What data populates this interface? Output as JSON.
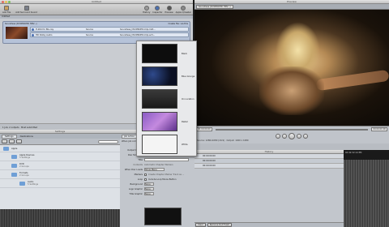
{
  "compressor": {
    "title": "Untitled",
    "toolbar": [
      "Add File",
      "Add Surround Sound"
    ],
    "right_tools": [
      "History",
      "Inspector",
      "Preview",
      "Apple Qmaster"
    ],
    "batch_tab": "Untitled",
    "job_name": "Soundless (DVCPROHD HDV...)",
    "create_file_label": "Create file: via this",
    "targets": [
      {
        "setting": "H.264 for Blu-ray",
        "dest": "Source",
        "output": "Soundless_DVCPROHD-Clip.m2t..."
      },
      {
        "setting": "HD Dolby Audio",
        "dest": "Source",
        "output": "Soundless_DVCPROHD-Clip.ac3..."
      }
    ],
    "status": "1 Job, 2 outputs · Most submitted"
  },
  "templates": {
    "items": [
      "Black",
      "Blue Grunge",
      "On Location",
      "Pastel",
      "White"
    ]
  },
  "settings": {
    "title": "Settings",
    "tabs": [
      "Settings",
      "Destinations"
    ],
    "groups": [
      {
        "name": "Apple",
        "count": ""
      },
      {
        "name": "Apple Devices",
        "count": "5 Settings"
      },
      {
        "name": "DVD",
        "count": "2 Groups"
      },
      {
        "name": "Formats",
        "count": "2 Groups"
      },
      {
        "name": "Audio",
        "count": "5 Settings"
      }
    ]
  },
  "inspector": {
    "tabs": [
      "Job Action"
    ],
    "when_label": "When job com...",
    "labels": [
      "Output Device",
      "Disc Template",
      "Title",
      "Contents",
      "Automatic Chapter Markers",
      "When Disc Loads",
      "Markers",
      "Loop",
      "Background",
      "Logo Graphic",
      "Title Graphic"
    ],
    "disc_template_value": "Black",
    "when_disc_loads_value": "Show Menu",
    "markers_value": "Create Chapter Marker Track as ...",
    "loop_value": "Include Loop Movie Button",
    "background_value": "None",
    "logo_value": "None",
    "title_graphic_value": "None"
  },
  "preview": {
    "title": "Preview",
    "header": "Soundless (DVCPROHD HDV...)",
    "timecode_left": "00:00:00:00",
    "timecode_right": "00:00:00:00",
    "info": "Source: 1280x1080 (16:9) · Output: 1920 x 1080",
    "history_title": "History",
    "history_rows": [
      "00:00:00:00",
      "00:00:00:00",
      "00:00:00:00"
    ],
    "history_date": "04 02:32:14 PM",
    "footer_buttons": [
      "Clear",
      "Remove Out Finish"
    ]
  }
}
